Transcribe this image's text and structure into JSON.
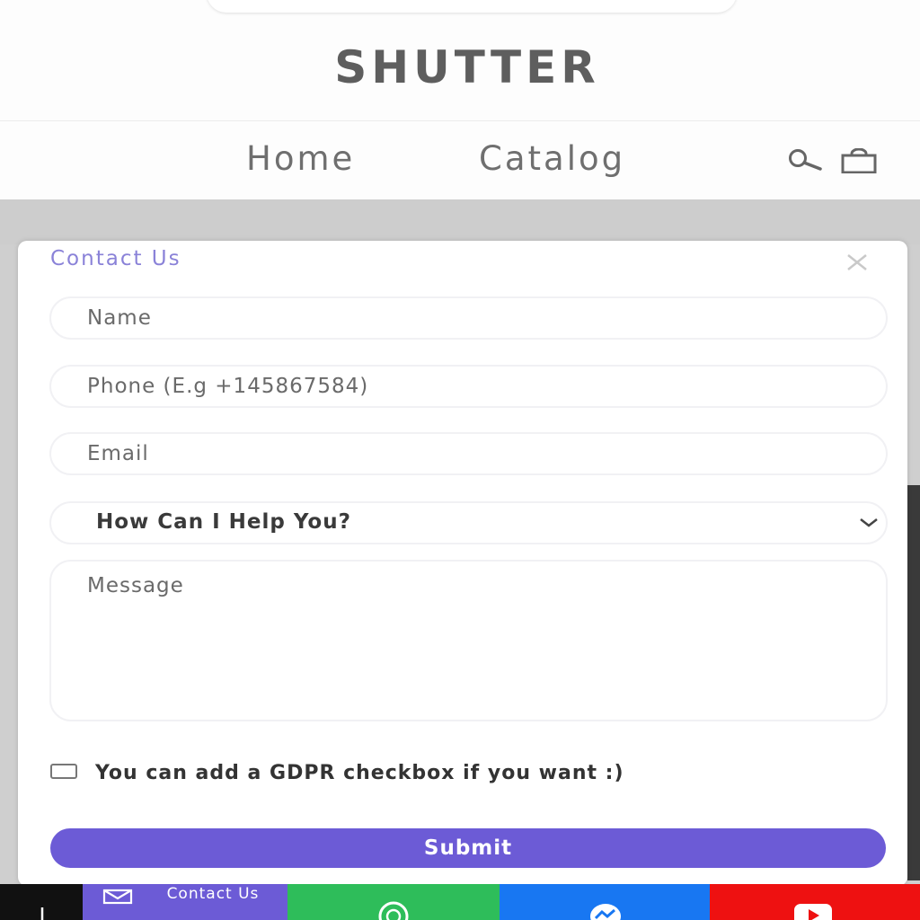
{
  "header": {
    "logo": "SHUTTER",
    "nav": [
      {
        "label": "Home"
      },
      {
        "label": "Catalog"
      }
    ],
    "icons": [
      "search-icon",
      "shopping-bag-icon"
    ]
  },
  "contact_form": {
    "title": "Contact Us",
    "close_icon": "close-icon",
    "name_placeholder": "Name",
    "phone_placeholder": "Phone (E.g +145867584)",
    "email_placeholder": "Email",
    "help_select": {
      "selected": "How Can I Help You?"
    },
    "message_placeholder": "Message",
    "gdpr_label": "You can add a GDPR checkbox if you want :)",
    "gdpr_checked": false,
    "submit_label": "Submit",
    "accent_color": "#6c5bd6"
  },
  "bottom_bar": {
    "contact_label": "Contact Us",
    "items": [
      "arrow-up-icon",
      "mail-icon",
      "whatsapp-icon",
      "messenger-icon",
      "youtube-icon"
    ],
    "colors": {
      "contact": "#6c5bd6",
      "whatsapp": "#2ebd5a",
      "messenger": "#1877f2",
      "youtube": "#ee1111"
    }
  }
}
